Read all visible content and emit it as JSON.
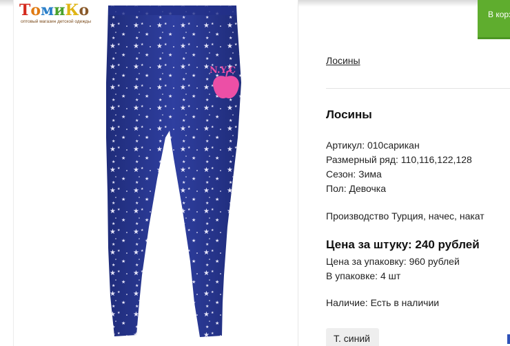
{
  "logo": {
    "letters": [
      {
        "char": "Т",
        "color": "#d42a1e"
      },
      {
        "char": "о",
        "color": "#e07a12"
      },
      {
        "char": "м",
        "color": "#2a7fc9"
      },
      {
        "char": "и",
        "color": "#4aa22c"
      },
      {
        "char": "К",
        "color": "#e0b514"
      },
      {
        "char": "о",
        "color": "#8a5a2b"
      }
    ],
    "tagline": "оптовый магазин детской одежды"
  },
  "product_image": {
    "subject": "leggings",
    "base_color": "#2b3a96",
    "stars_color": "#ffffff",
    "print_text": "N.Y.C",
    "print_color": "#ec4fa6"
  },
  "cart_button": {
    "label": "В корзину"
  },
  "breadcrumb": {
    "label": "Лосины"
  },
  "product": {
    "title": "Лосины",
    "article": "Артикул: 010сарикан",
    "sizes": "Размерный ряд: 110,116,122,128",
    "season": "Сезон: Зима",
    "gender": "Пол: Девочка",
    "production": "Производство Турция, начес, накат",
    "price_per_item": "Цена за штуку: 240 рублей",
    "price_per_pack": "Цена за упаковку: 960 рублей",
    "pack_qty": "В упаковке: 4 шт",
    "availability": "Наличие: Есть в наличии",
    "color_option": "Т. синий"
  },
  "colors": {
    "accent_green": "#5fad2e",
    "text": "#222222"
  }
}
